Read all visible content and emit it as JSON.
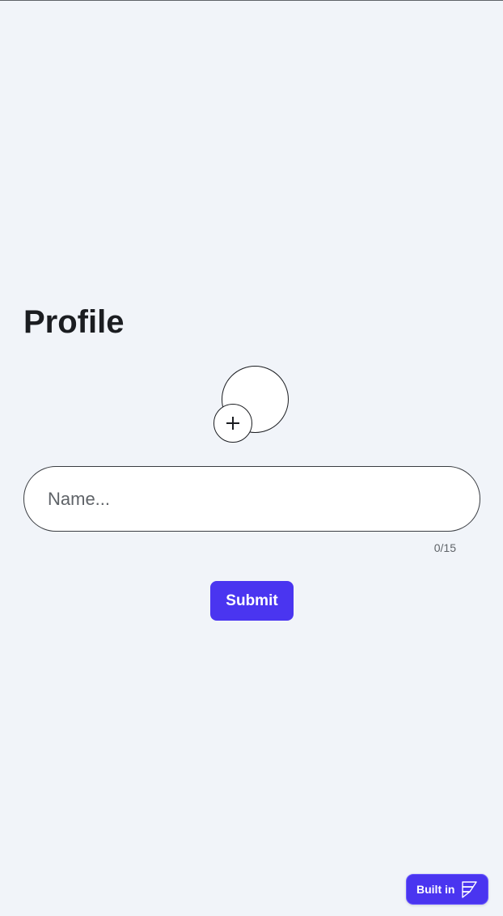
{
  "page": {
    "title": "Profile"
  },
  "avatar": {
    "add_icon": "plus-icon"
  },
  "name_field": {
    "placeholder": "Name...",
    "value": "",
    "counter": "0/15"
  },
  "submit": {
    "label": "Submit"
  },
  "badge": {
    "label": "Built in",
    "logo_icon": "framer-style-logo-icon"
  },
  "colors": {
    "background": "#f1f4f9",
    "accent": "#4a35f0",
    "text": "#1b1d21",
    "muted": "#5f6368"
  }
}
